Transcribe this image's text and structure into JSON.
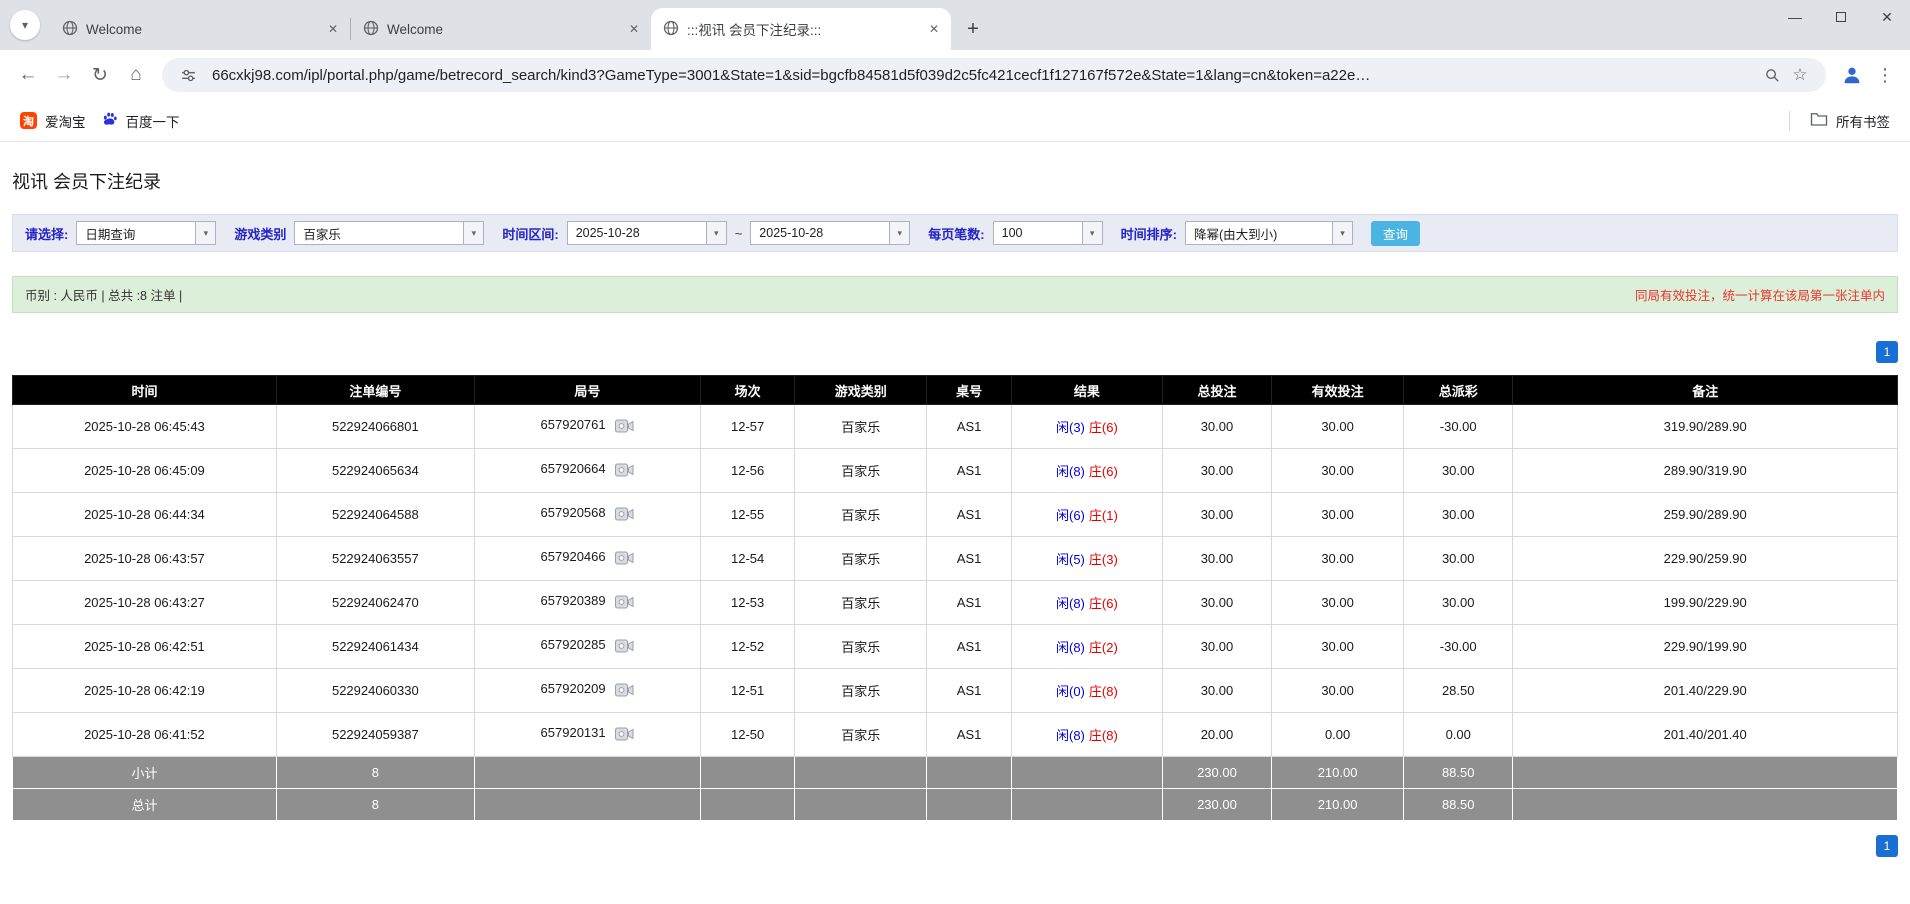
{
  "icons": {
    "close": "✕",
    "minimize": "—",
    "new_tab": "+",
    "back": "←",
    "forward": "→",
    "reload": "↻",
    "home": "⌂",
    "star": "☆",
    "kebab": "⋮",
    "chevron_down": "▾",
    "taobao_glyph": "淘"
  },
  "colors": {
    "table_header_bg": "#000000",
    "summary_row_bg": "#8f8f8f",
    "player_blue": "#0000e6",
    "banker_red": "#e60000",
    "amount_link_blue": "#0066cc",
    "negative_red": "#e60000",
    "search_button_blue": "#4bb4e3",
    "pagination_blue": "#1a6fd4",
    "summary_bar_green": "#dcefd8",
    "filter_label_blue": "#2323c8",
    "notice_red": "#e8352b"
  },
  "browser": {
    "tabs": [
      {
        "title": "Welcome"
      },
      {
        "title": "Welcome"
      },
      {
        "title": ":::视讯 会员下注纪录:::"
      }
    ],
    "url": "66cxkj98.com/ipl/portal.php/game/betrecord_search/kind3?GameType=3001&State=1&sid=bgcfb84581d5f039d2c5fc421cecf1f127167f572e&State=1&lang=cn&token=a22e…",
    "bookmarks": [
      {
        "label": "爱淘宝"
      },
      {
        "label": "百度一下"
      }
    ],
    "all_bookmarks_label": "所有书签"
  },
  "page": {
    "title": "视讯 会员下注纪录",
    "filters": {
      "select_label": "请选择:",
      "query_type": "日期查询",
      "game_type_label": "游戏类别",
      "game_type": "百家乐",
      "date_range_label": "时间区间:",
      "date_from": "2025-10-28",
      "date_separator": "~",
      "date_to": "2025-10-28",
      "page_size_label": "每页笔数:",
      "page_size": "100",
      "sort_label": "时间排序:",
      "sort_order": "降幂(由大到小)",
      "search_button": "查询"
    },
    "summary_bar": {
      "left_text": "币别 : 人民币 | 总共 :8 注单 |",
      "right_notice": "同局有效投注，统一计算在该局第一张注单内"
    },
    "pagination": {
      "page": "1"
    },
    "table": {
      "headers": [
        "时间",
        "注单编号",
        "局号",
        "场次",
        "游戏类别",
        "桌号",
        "结果",
        "总投注",
        "有效投注",
        "总派彩",
        "备注"
      ],
      "rows": [
        {
          "time": "2025-10-28 06:45:43",
          "bet_id": "522924066801",
          "round": "657920761",
          "session": "12-57",
          "game": "百家乐",
          "table": "AS1",
          "player": "闲(3)",
          "banker": "庄(6)",
          "total_bet": "30.00",
          "valid_bet": "30.00",
          "payout": "-30.00",
          "note": "319.90/289.90"
        },
        {
          "time": "2025-10-28 06:45:09",
          "bet_id": "522924065634",
          "round": "657920664",
          "session": "12-56",
          "game": "百家乐",
          "table": "AS1",
          "player": "闲(8)",
          "banker": "庄(6)",
          "total_bet": "30.00",
          "valid_bet": "30.00",
          "payout": "30.00",
          "note": "289.90/319.90"
        },
        {
          "time": "2025-10-28 06:44:34",
          "bet_id": "522924064588",
          "round": "657920568",
          "session": "12-55",
          "game": "百家乐",
          "table": "AS1",
          "player": "闲(6)",
          "banker": "庄(1)",
          "total_bet": "30.00",
          "valid_bet": "30.00",
          "payout": "30.00",
          "note": "259.90/289.90"
        },
        {
          "time": "2025-10-28 06:43:57",
          "bet_id": "522924063557",
          "round": "657920466",
          "session": "12-54",
          "game": "百家乐",
          "table": "AS1",
          "player": "闲(5)",
          "banker": "庄(3)",
          "total_bet": "30.00",
          "valid_bet": "30.00",
          "payout": "30.00",
          "note": "229.90/259.90"
        },
        {
          "time": "2025-10-28 06:43:27",
          "bet_id": "522924062470",
          "round": "657920389",
          "session": "12-53",
          "game": "百家乐",
          "table": "AS1",
          "player": "闲(8)",
          "banker": "庄(6)",
          "total_bet": "30.00",
          "valid_bet": "30.00",
          "payout": "30.00",
          "note": "199.90/229.90"
        },
        {
          "time": "2025-10-28 06:42:51",
          "bet_id": "522924061434",
          "round": "657920285",
          "session": "12-52",
          "game": "百家乐",
          "table": "AS1",
          "player": "闲(8)",
          "banker": "庄(2)",
          "total_bet": "30.00",
          "valid_bet": "30.00",
          "payout": "-30.00",
          "note": "229.90/199.90"
        },
        {
          "time": "2025-10-28 06:42:19",
          "bet_id": "522924060330",
          "round": "657920209",
          "session": "12-51",
          "game": "百家乐",
          "table": "AS1",
          "player": "闲(0)",
          "banker": "庄(8)",
          "total_bet": "30.00",
          "valid_bet": "30.00",
          "payout": "28.50",
          "note": "201.40/229.90"
        },
        {
          "time": "2025-10-28 06:41:52",
          "bet_id": "522924059387",
          "round": "657920131",
          "session": "12-50",
          "game": "百家乐",
          "table": "AS1",
          "player": "闲(8)",
          "banker": "庄(8)",
          "total_bet": "20.00",
          "valid_bet": "0.00",
          "payout": "0.00",
          "note": "201.40/201.40"
        }
      ],
      "subtotal": {
        "label": "小计",
        "count": "8",
        "total_bet": "230.00",
        "valid_bet": "210.00",
        "payout": "88.50"
      },
      "total": {
        "label": "总计",
        "count": "8",
        "total_bet": "230.00",
        "valid_bet": "210.00",
        "payout": "88.50"
      }
    }
  }
}
